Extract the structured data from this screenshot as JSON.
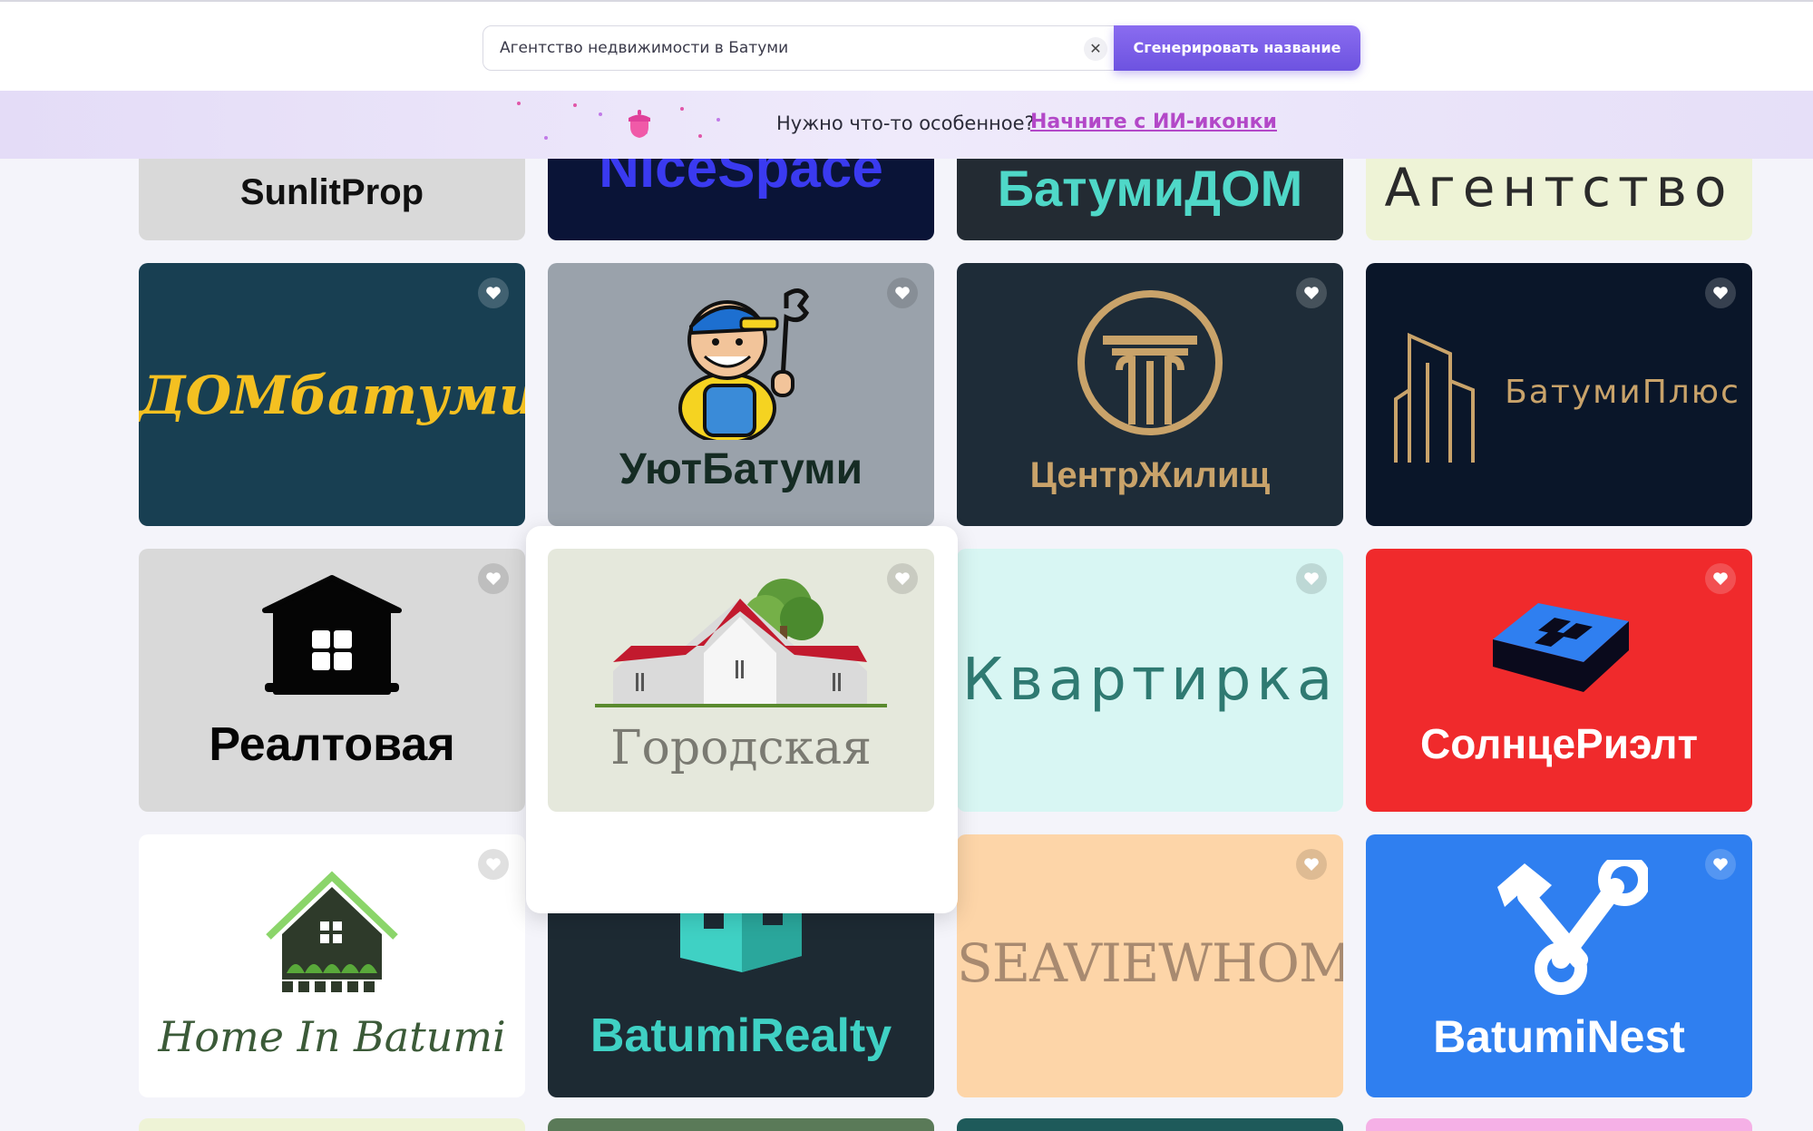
{
  "search": {
    "value": "Агентство недвижимости в Батуми",
    "clear_icon": "✕",
    "generate_label": "Сгенерировать название"
  },
  "banner": {
    "text": "Нужно что-то особенное?",
    "link": "Начните с ИИ-иконки"
  },
  "logos": [
    {
      "name": "SunlitProp",
      "bg": "#d9d9d9",
      "color": "#111111"
    },
    {
      "name": "NiceSpace",
      "bg": "#0a1437",
      "color": "#3a3af0"
    },
    {
      "name": "БатумиДОМ",
      "bg": "#232b33",
      "color": "#4fd8c8"
    },
    {
      "name": "Агентство",
      "bg": "#eef3d6",
      "color": "#2a2a2a"
    },
    {
      "name": "ДОМбатуми",
      "bg": "#183f52",
      "color": "#f4c021"
    },
    {
      "name": "УютБатуми",
      "bg": "#9aa2ab",
      "color": "#152b23"
    },
    {
      "name": "ЦентрЖилищ",
      "bg": "#1e2c38",
      "color": "#c9a36a"
    },
    {
      "name": "БатумиПлюс",
      "bg": "#0a1629",
      "color": "#c9a36a"
    },
    {
      "name": "Реалтовая",
      "bg": "#d9d9d9",
      "color": "#050505"
    },
    {
      "name": "Городская",
      "bg": "#e5e8dc",
      "color": "#7a7a72"
    },
    {
      "name": "Квартирка",
      "bg": "#d8f6f3",
      "color": "#2f7a72"
    },
    {
      "name": "СолнцеРиэлт",
      "bg": "#f02a2c",
      "color": "#ffffff"
    },
    {
      "name": "Home In Batumi",
      "bg": "#ffffff",
      "color": "#3b5a38"
    },
    {
      "name": "BatumiRealty",
      "bg": "#1d2a33",
      "color": "#3fd1c4"
    },
    {
      "name": "SEAVIEWHOMES",
      "bg": "#fdd5a8",
      "color": "#a88a70"
    },
    {
      "name": "BatumiNest",
      "bg": "#2f7ff0",
      "color": "#ffffff"
    }
  ],
  "icons": {
    "heart": "heart-icon",
    "clear": "close-icon",
    "acorn": "acorn-icon"
  }
}
